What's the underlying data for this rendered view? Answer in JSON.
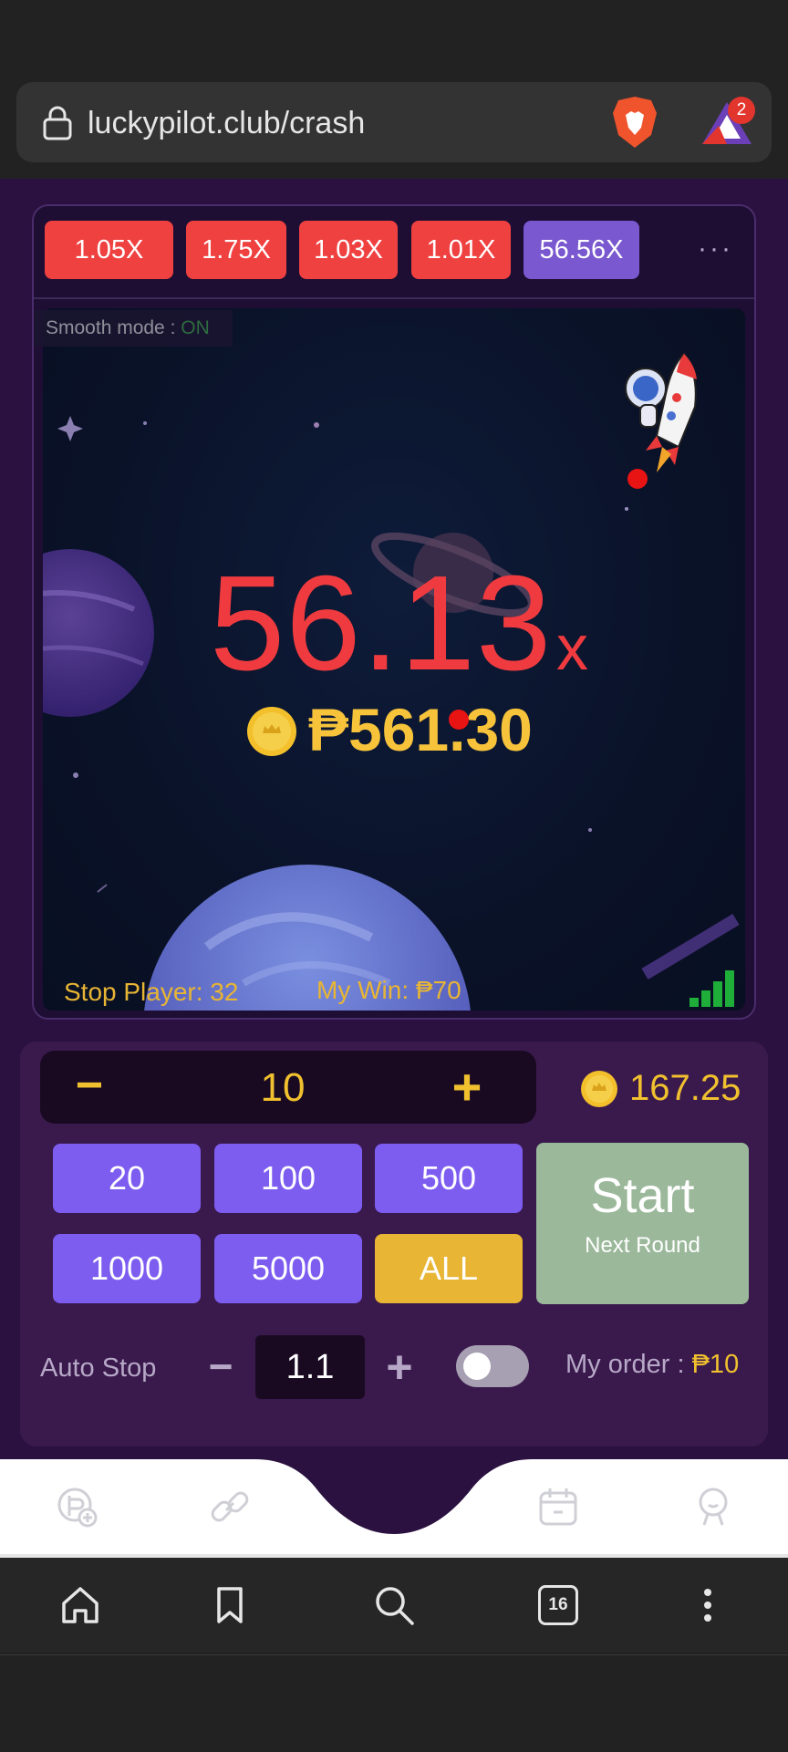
{
  "browser": {
    "url": "luckypilot.club/crash",
    "notification_count": "2",
    "tab_count": "16"
  },
  "game": {
    "history": [
      "1.05X",
      "1.75X",
      "1.03X",
      "1.01X",
      "56.56X"
    ],
    "smooth_mode_label": "Smooth mode : ",
    "smooth_mode_state": "ON",
    "multiplier": "56.13",
    "multiplier_suffix": "x",
    "payout": "₱561.30",
    "stop_player": "Stop Player: 32",
    "my_win": "My Win: ₱70"
  },
  "bet": {
    "minus_label": "−",
    "amount": "10",
    "plus_label": "+",
    "balance": "167.25",
    "quick_amounts": [
      "20",
      "100",
      "500",
      "1000",
      "5000",
      "ALL"
    ],
    "start_label": "Start",
    "start_sub": "Next Round",
    "auto_stop_label": "Auto Stop",
    "auto_stop_value": "1.1",
    "my_order_label": "My order : ",
    "my_order_amount": "₱10"
  },
  "colors": {
    "history_red": "#f04141",
    "history_purple": "#7a58d0",
    "multiplier": "#ef3b3f",
    "gold": "#f0c02f",
    "quick_button": "#7d5cf0",
    "start_button": "#9bb89b"
  },
  "icons": {
    "app_nav": [
      "coin-add-icon",
      "link-icon",
      "calendar-icon",
      "profile-icon"
    ],
    "browser_nav": [
      "home-icon",
      "bookmark-icon",
      "search-icon",
      "tabs-icon",
      "more-vert-icon"
    ]
  }
}
